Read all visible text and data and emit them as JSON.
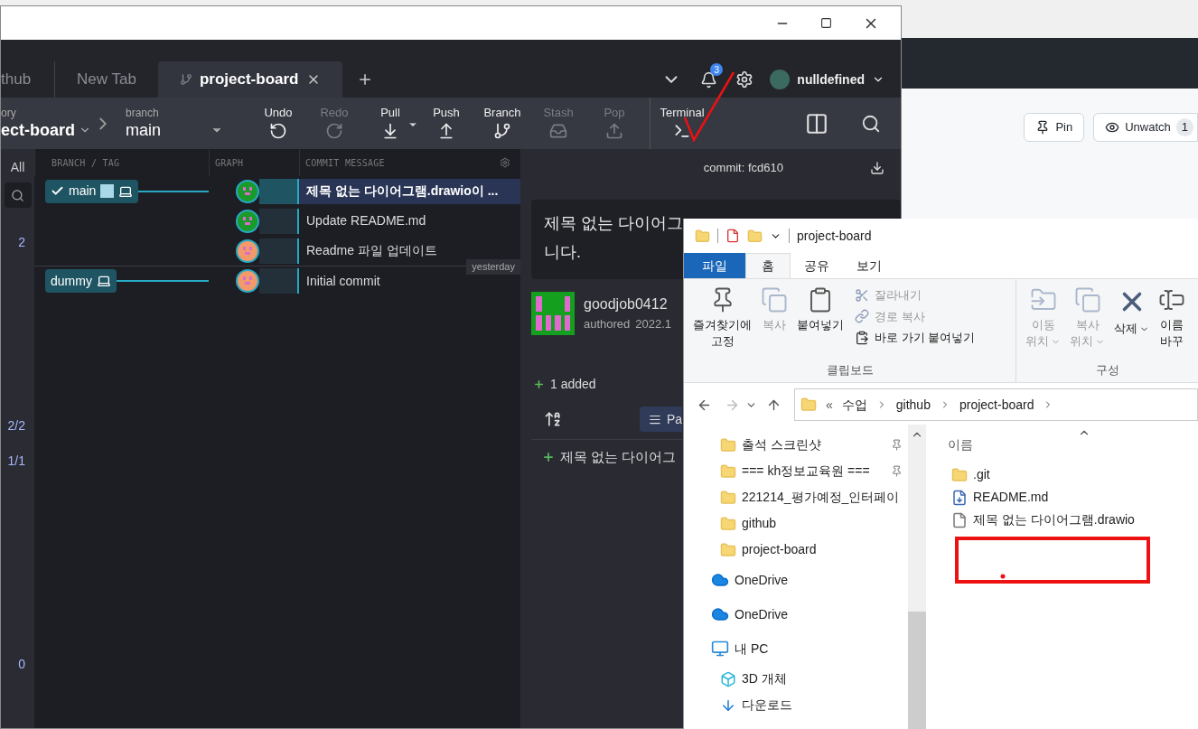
{
  "browser": {
    "pin": "Pin",
    "unwatch": "Unwatch",
    "watch_count": "1"
  },
  "gitkraken": {
    "tabs": [
      {
        "label": "thub",
        "selected": false
      },
      {
        "label": "New Tab",
        "selected": false
      },
      {
        "label": "project-board",
        "selected": true
      }
    ],
    "notifications": "3",
    "user": "nulldefined",
    "repo": {
      "label": "ory",
      "value": "ect-board"
    },
    "branch": {
      "label": "branch",
      "value": "main"
    },
    "actions": [
      {
        "label": "Undo",
        "kind": "undo",
        "disabled": false
      },
      {
        "label": "Redo",
        "kind": "redo",
        "disabled": true
      },
      {
        "label": "Pull",
        "kind": "pull",
        "disabled": false
      },
      {
        "label": "Push",
        "kind": "push",
        "disabled": false
      },
      {
        "label": "Branch",
        "kind": "branch",
        "disabled": false
      },
      {
        "label": "Stash",
        "kind": "stash",
        "disabled": true
      },
      {
        "label": "Pop",
        "kind": "pop",
        "disabled": true
      },
      {
        "label": "Terminal",
        "kind": "terminal",
        "disabled": false
      }
    ],
    "left_strip": {
      "filter": "All",
      "counts": [
        "2",
        "2/2",
        "1/1",
        "0"
      ]
    },
    "columns": [
      "BRANCH / TAG",
      "GRAPH",
      "COMMIT MESSAGE"
    ],
    "commits": [
      {
        "message": "제목 없는 다이어그램.drawio이 ...",
        "selected": true,
        "branch": "main",
        "checked": true,
        "color": "#1a9a2a"
      },
      {
        "message": "Update README.md",
        "selected": false,
        "color": "#1a9a2a"
      },
      {
        "message": "Readme 파일 업데이트",
        "selected": false,
        "color": "#f39a6a",
        "date": "yesterday"
      },
      {
        "message": "Initial commit",
        "selected": false,
        "branch": "dummy",
        "checked": false,
        "color": "#f39a6a"
      }
    ],
    "detail": {
      "commit": "commit: fcd610",
      "message_lines": [
        "제목 없는 다이어그",
        "니다."
      ],
      "author": "goodjob0412",
      "authored": "authored",
      "date": "2022.1",
      "added": "1 added",
      "path_button": "Pa",
      "files": [
        "제목 없는 다이어그"
      ]
    }
  },
  "explorer": {
    "title": "project-board",
    "tabs": [
      {
        "label": "파일",
        "kind": "file"
      },
      {
        "label": "홈",
        "kind": "tab",
        "selected": true
      },
      {
        "label": "공유",
        "kind": "tab",
        "selected": false
      },
      {
        "label": "보기",
        "kind": "tab",
        "selected": false
      }
    ],
    "groups": [
      {
        "label": "클립보드",
        "items": [
          {
            "label": "즐겨찾기에 고정",
            "kind": "pin",
            "disabled": false
          },
          {
            "label": "복사",
            "kind": "copy",
            "disabled": true
          },
          {
            "label": "붙여넣기",
            "kind": "paste",
            "disabled": false
          }
        ],
        "small_items": [
          {
            "label": "잘라내기",
            "kind": "cut",
            "disabled": true
          },
          {
            "label": "경로 복사",
            "kind": "path",
            "disabled": true
          },
          {
            "label": "바로 가기 붙여넣기",
            "kind": "shortcut",
            "disabled": false
          }
        ]
      },
      {
        "label": "구성",
        "items": [
          {
            "label": "이동 위치",
            "kind": "move",
            "disabled": true,
            "dropdown": true
          },
          {
            "label": "복사 위치",
            "kind": "copyto",
            "disabled": true,
            "dropdown": true
          },
          {
            "label": "삭제",
            "kind": "delete",
            "disabled": false,
            "dropdown": true
          },
          {
            "label": "이름 바꾸",
            "kind": "rename",
            "disabled": false
          }
        ]
      }
    ],
    "path_prefix": "«",
    "path": [
      "수업",
      "github",
      "project-board"
    ],
    "nav": [
      {
        "label": "출석 스크린샷",
        "kind": "folder",
        "pinned": true
      },
      {
        "label": "=== kh정보교육원 ===",
        "kind": "folder",
        "pinned": true
      },
      {
        "label": "221214_평가예정_인터페이",
        "kind": "folder",
        "pinned": false
      },
      {
        "label": "github",
        "kind": "folder",
        "pinned": false
      },
      {
        "label": "project-board",
        "kind": "folder",
        "pinned": false
      },
      {
        "label": "OneDrive",
        "kind": "cloud",
        "pinned": false
      },
      {
        "label": "OneDrive",
        "kind": "cloud",
        "pinned": false
      },
      {
        "label": "내 PC",
        "kind": "pc",
        "pinned": false
      },
      {
        "label": "3D 개체",
        "kind": "objects",
        "pinned": false
      },
      {
        "label": "다운로드",
        "kind": "downloads",
        "pinned": false
      }
    ],
    "column": "이름",
    "files": [
      {
        "name": ".git",
        "kind": "folder"
      },
      {
        "name": "README.md",
        "kind": "markdown"
      },
      {
        "name": "제목 없는 다이어그램.drawio",
        "kind": "file"
      }
    ]
  }
}
